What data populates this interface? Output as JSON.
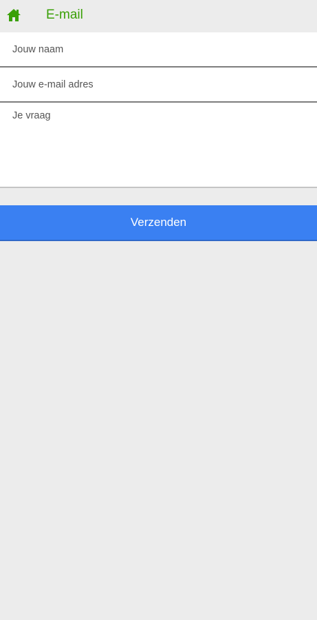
{
  "header": {
    "title": "E-mail",
    "home_icon": "home-icon",
    "accent_color": "#3aa007"
  },
  "form": {
    "name_placeholder": "Jouw naam",
    "email_placeholder": "Jouw e-mail adres",
    "question_placeholder": "Je vraag",
    "name_value": "",
    "email_value": "",
    "question_value": ""
  },
  "actions": {
    "send_label": "Verzenden",
    "send_color": "#3a80f2"
  }
}
